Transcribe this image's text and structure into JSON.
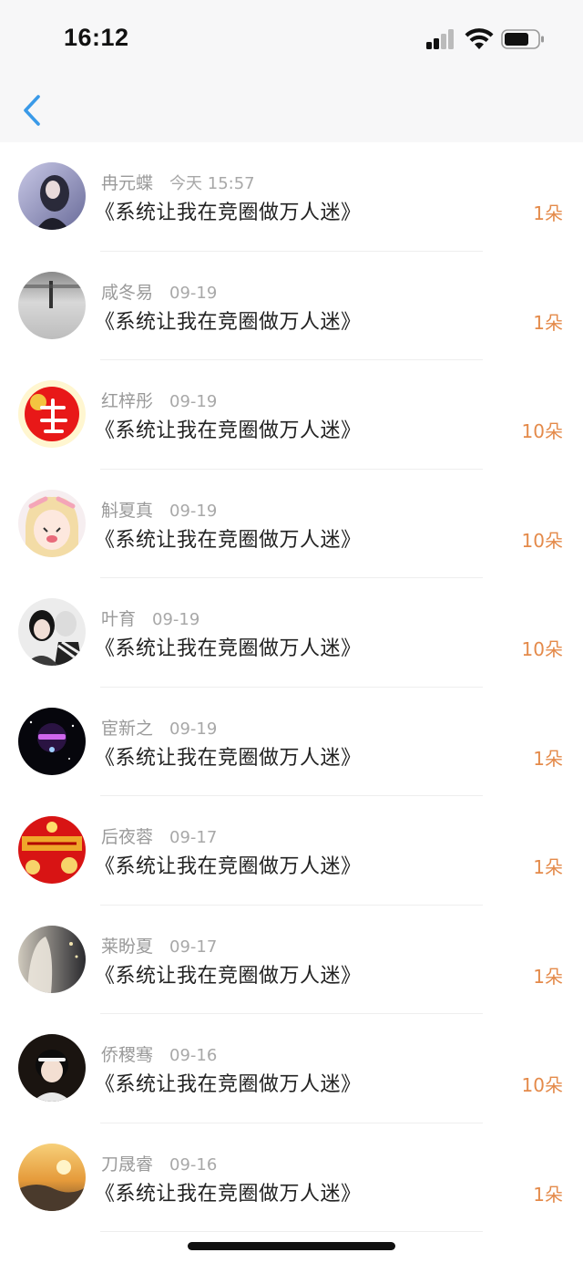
{
  "status_bar": {
    "time": "16:12"
  },
  "nav": {
    "back_icon": "chevron-left-icon",
    "accent": "#3a9ae8"
  },
  "colors": {
    "count": "#e48a4a",
    "meta": "#9a9a9a"
  },
  "items": [
    {
      "name": "冉元蝶",
      "date": "今天 15:57",
      "book": "《系统让我在竞圈做万人迷》",
      "count": "1朵"
    },
    {
      "name": "咸冬易",
      "date": "09-19",
      "book": "《系统让我在竞圈做万人迷》",
      "count": "1朵"
    },
    {
      "name": "红梓彤",
      "date": "09-19",
      "book": "《系统让我在竞圈做万人迷》",
      "count": "10朵"
    },
    {
      "name": "斛夏真",
      "date": "09-19",
      "book": "《系统让我在竞圈做万人迷》",
      "count": "10朵"
    },
    {
      "name": "叶育",
      "date": "09-19",
      "book": "《系统让我在竞圈做万人迷》",
      "count": "10朵"
    },
    {
      "name": "宦新之",
      "date": "09-19",
      "book": "《系统让我在竞圈做万人迷》",
      "count": "1朵"
    },
    {
      "name": "后夜蓉",
      "date": "09-17",
      "book": "《系统让我在竞圈做万人迷》",
      "count": "1朵"
    },
    {
      "name": "莱盼夏",
      "date": "09-17",
      "book": "《系统让我在竞圈做万人迷》",
      "count": "1朵"
    },
    {
      "name": "侨稷骞",
      "date": "09-16",
      "book": "《系统让我在竞圈做万人迷》",
      "count": "10朵"
    },
    {
      "name": "刀晟睿",
      "date": "09-16",
      "book": "《系统让我在竞圈做万人迷》",
      "count": "1朵"
    }
  ]
}
